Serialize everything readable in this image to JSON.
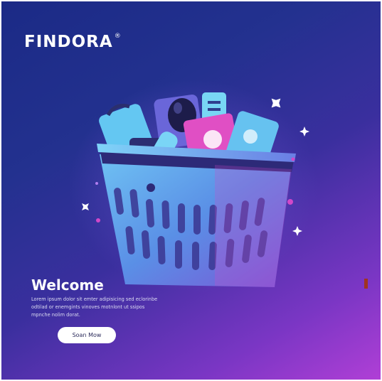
{
  "brand": {
    "name": "FINDORA",
    "mark": "®"
  },
  "hero": {
    "title": "Welcome",
    "description": "Lorem ipsum dolor sit emter adipisicing sed eclorinbe odtilad or enemgints vinoves motnlont ut ssipos mpnche nolim dorat.",
    "cta_label": "Soan Mow"
  },
  "colors": {
    "background_top": "#1b2a86",
    "background_bottom": "#b03fd6",
    "basket": "#4fa2ea",
    "accent": "#d148c9",
    "button": "#ffffff"
  },
  "icons": [
    "shopping-basket-icon",
    "sparkle-icon"
  ]
}
